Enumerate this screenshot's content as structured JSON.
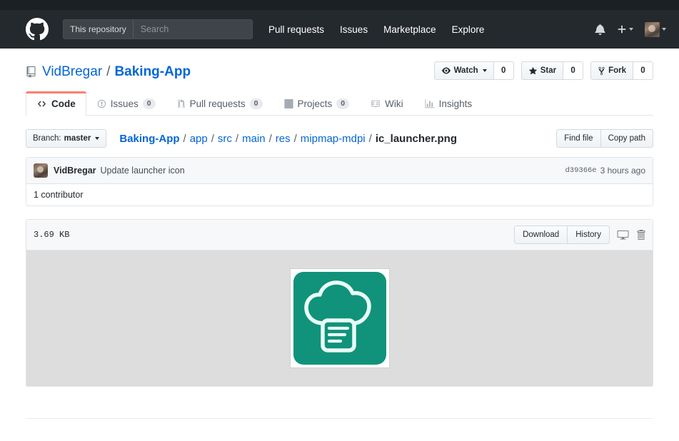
{
  "header": {
    "logo_icon": "github-mark-icon",
    "search": {
      "scope": "This repository",
      "placeholder": "Search",
      "value": ""
    },
    "nav": [
      {
        "label": "Pull requests"
      },
      {
        "label": "Issues"
      },
      {
        "label": "Marketplace"
      },
      {
        "label": "Explore"
      }
    ],
    "notifications_icon": "bell-icon",
    "create_new_icon": "plus-icon",
    "avatar_alt": "user-avatar"
  },
  "repo": {
    "icon": "repo-icon",
    "owner": "VidBregar",
    "separator": "/",
    "name": "Baking-App",
    "actions": [
      {
        "id": "watch",
        "label": "Watch",
        "icon": "eye-icon",
        "count": "0",
        "has_caret": true
      },
      {
        "id": "star",
        "label": "Star",
        "icon": "star-icon",
        "count": "0",
        "has_caret": false
      },
      {
        "id": "fork",
        "label": "Fork",
        "icon": "fork-icon",
        "count": "0",
        "has_caret": false
      }
    ]
  },
  "tabs": [
    {
      "id": "code",
      "label": "Code",
      "icon": "code-icon",
      "count": null,
      "active": true
    },
    {
      "id": "issues",
      "label": "Issues",
      "icon": "issue-opened-icon",
      "count": "0",
      "active": false
    },
    {
      "id": "pull-requests",
      "label": "Pull requests",
      "icon": "git-pull-request-icon",
      "count": "0",
      "active": false
    },
    {
      "id": "projects",
      "label": "Projects",
      "icon": "project-board-icon",
      "count": "0",
      "active": false
    },
    {
      "id": "wiki",
      "label": "Wiki",
      "icon": "book-icon",
      "count": null,
      "active": false
    },
    {
      "id": "insights",
      "label": "Insights",
      "icon": "graph-icon",
      "count": null,
      "active": false
    }
  ],
  "file_nav": {
    "branch_prefix": "Branch:",
    "branch_name": "master",
    "path": [
      {
        "label": "Baking-App",
        "is_link": true,
        "is_root": true
      },
      {
        "label": "app",
        "is_link": true
      },
      {
        "label": "src",
        "is_link": true
      },
      {
        "label": "main",
        "is_link": true
      },
      {
        "label": "res",
        "is_link": true
      },
      {
        "label": "mipmap-mdpi",
        "is_link": true
      },
      {
        "label": "ic_launcher.png",
        "is_link": false
      }
    ],
    "find_file_label": "Find file",
    "copy_path_label": "Copy path"
  },
  "commit": {
    "author": "VidBregar",
    "message": "Update launcher icon",
    "sha": "d39366e",
    "time": "3 hours ago",
    "contributors": "1 contributor"
  },
  "blob": {
    "size": "3.69 KB",
    "download_label": "Download",
    "history_label": "History",
    "open_desktop_icon": "device-desktop-icon",
    "delete_icon": "trash-icon",
    "image_name": "ic_launcher.png",
    "image_alt": "chef-hat-recipe-app-icon"
  },
  "colors": {
    "header_bg": "#24292e",
    "link_blue": "#0366d6",
    "active_tab_accent": "#f9826c",
    "icon_teal": "#10937a",
    "icon_stroke": "#e9fdf6",
    "blob_bg": "#ddddde",
    "border": "#e1e4e8"
  }
}
